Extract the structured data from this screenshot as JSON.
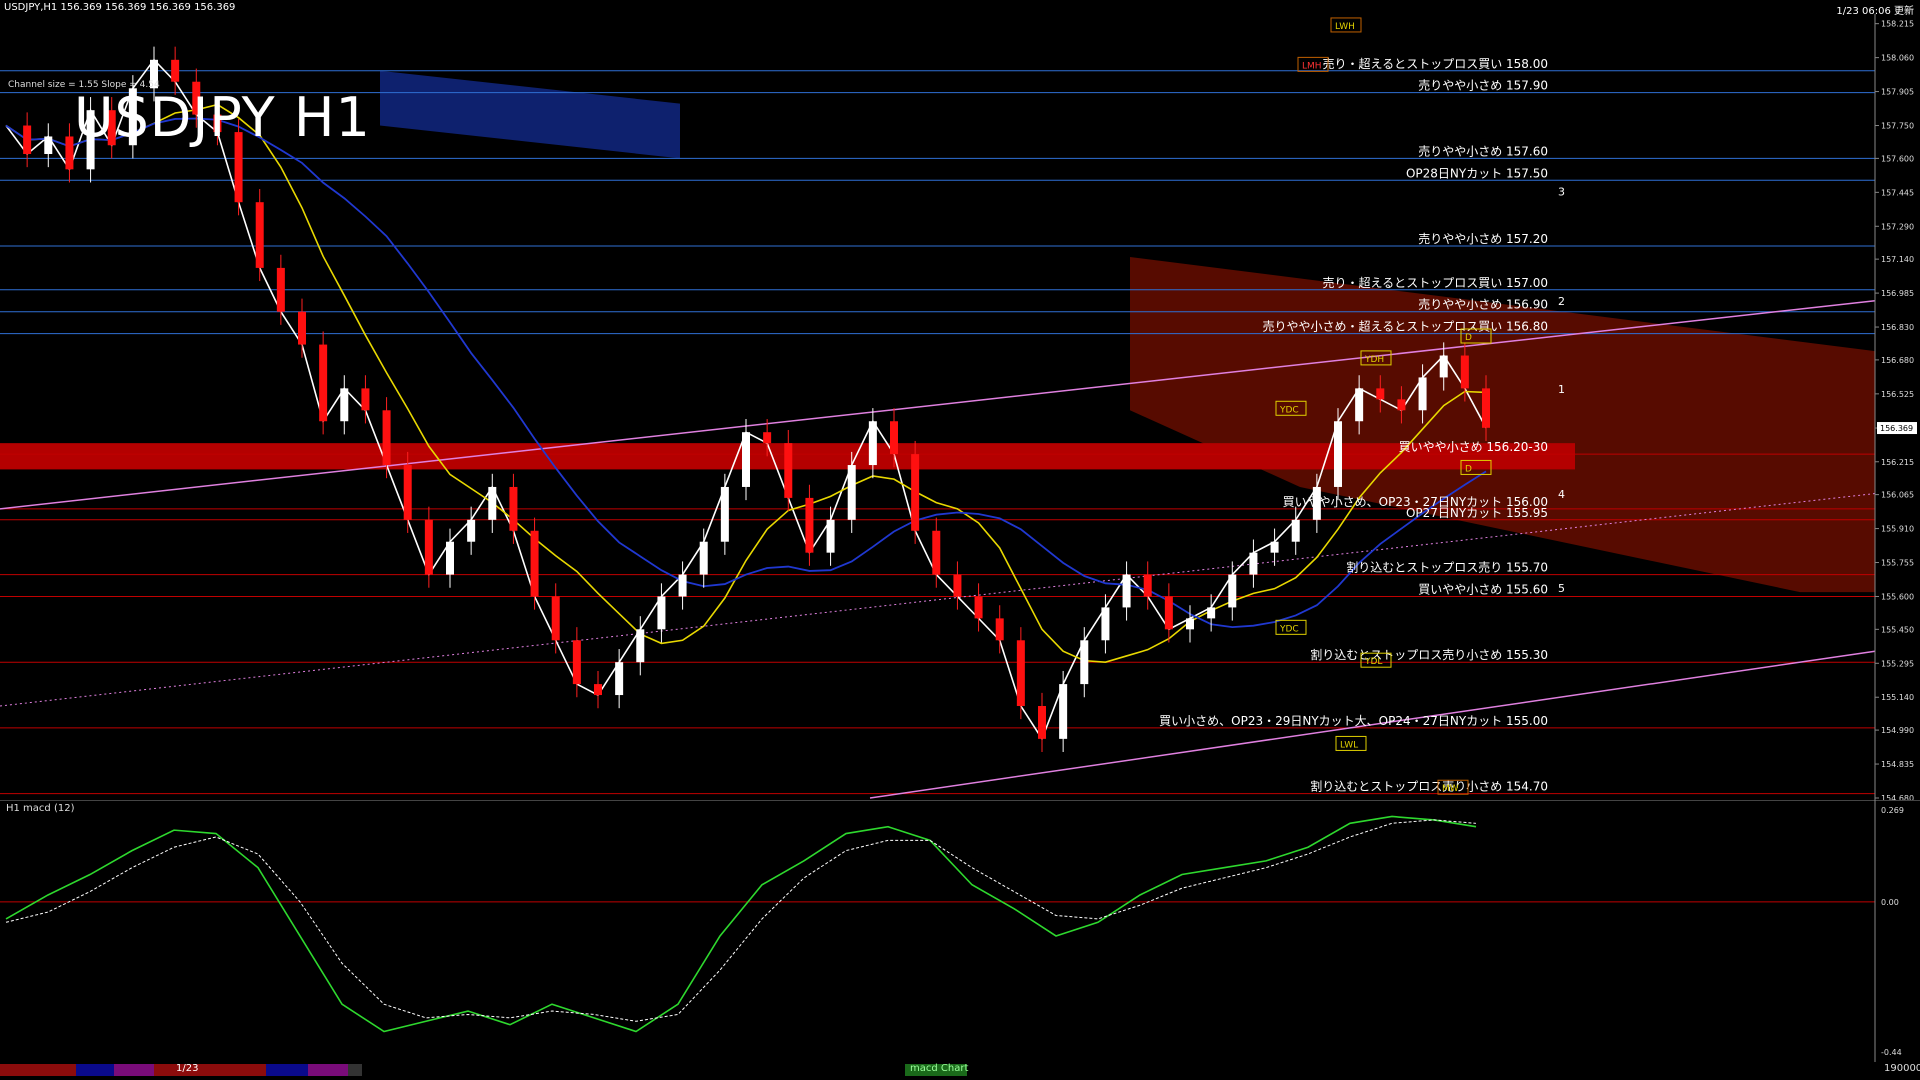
{
  "window": {
    "symbol_info": "USDJPY,H1  156.369 156.369 156.369 156.369",
    "updated": "1/23 06:06 更新",
    "big_title": "USDJPY H1",
    "channel_info": "Channel size = 1.55 Slope = 4.54"
  },
  "chart_data": {
    "type": "line",
    "title": "USDJPY H1",
    "ylim": [
      154.68,
      158.25
    ],
    "yticks": [
      "158.215",
      "158.060",
      "157.905",
      "157.750",
      "157.600",
      "157.445",
      "157.290",
      "157.140",
      "156.985",
      "156.830",
      "156.680",
      "156.525",
      "156.369",
      "156.215",
      "156.065",
      "155.910",
      "155.755",
      "155.600",
      "155.450",
      "155.295",
      "155.140",
      "154.990",
      "154.835",
      "154.680"
    ],
    "current_price": "156.369",
    "close_series": [
      157.75,
      157.62,
      157.7,
      157.55,
      157.82,
      157.66,
      157.92,
      158.05,
      157.95,
      157.8,
      157.72,
      157.4,
      157.1,
      156.9,
      156.75,
      156.4,
      156.55,
      156.45,
      156.2,
      155.95,
      155.7,
      155.85,
      155.95,
      156.1,
      155.9,
      155.6,
      155.4,
      155.2,
      155.15,
      155.3,
      155.45,
      155.6,
      155.7,
      155.85,
      156.1,
      156.35,
      156.3,
      156.05,
      155.8,
      155.95,
      156.2,
      156.4,
      156.25,
      155.9,
      155.7,
      155.6,
      155.5,
      155.4,
      155.1,
      154.95,
      155.2,
      155.4,
      155.55,
      155.7,
      155.6,
      155.45,
      155.5,
      155.55,
      155.7,
      155.8,
      155.85,
      155.95,
      156.1,
      156.4,
      156.55,
      156.5,
      156.45,
      156.6,
      156.7,
      156.55,
      156.37
    ],
    "levels": [
      {
        "label": "売り・超えるとストップロス買い 158.00",
        "value": 158.0,
        "color": "#2f6fd4"
      },
      {
        "label": "売りやや小さめ 157.90",
        "value": 157.9,
        "color": "#2f6fd4"
      },
      {
        "label": "売りやや小さめ 157.60",
        "value": 157.6,
        "color": "#2f6fd4"
      },
      {
        "label": "OP28日NYカット 157.50",
        "value": 157.5,
        "color": "#2f6fd4"
      },
      {
        "label": "売りやや小さめ 157.20",
        "value": 157.2,
        "color": "#2f6fd4"
      },
      {
        "label": "売り・超えるとストップロス買い 157.00",
        "value": 157.0,
        "color": "#2f6fd4"
      },
      {
        "label": "売りやや小さめ 156.90",
        "value": 156.9,
        "color": "#2f6fd4"
      },
      {
        "label": "売りやや小さめ・超えるとストップロス買い 156.80",
        "value": 156.8,
        "color": "#2f6fd4"
      },
      {
        "label": "買いやや小さめ 156.20-30",
        "value": 156.25,
        "color": "#c00000"
      },
      {
        "label": "買いやや小さめ、OP23・27日NYカット 156.00",
        "value": 156.0,
        "color": "#c00000"
      },
      {
        "label": "OP27日NYカット 155.95",
        "value": 155.95,
        "color": "#c00000"
      },
      {
        "label": "割り込むとストップロス売り 155.70",
        "value": 155.7,
        "color": "#c00000"
      },
      {
        "label": "買いやや小さめ 155.60",
        "value": 155.6,
        "color": "#c00000"
      },
      {
        "label": "割り込むとストップロス売り小さめ 155.30",
        "value": 155.3,
        "color": "#c00000"
      },
      {
        "label": "買い小さめ、OP23・29日NYカット大、OP24・27日NYカット 155.00",
        "value": 155.0,
        "color": "#c00000"
      },
      {
        "label": "割り込むとストップロス売り小さめ 154.70",
        "value": 154.7,
        "color": "#c00000"
      }
    ],
    "markers": [
      "LWH",
      "LMH",
      "YDH",
      "YDC",
      "YDC",
      "YDL",
      "LWL",
      "MW",
      "D",
      "D"
    ],
    "projection_labels": [
      "1",
      "2",
      "3",
      "4",
      "5"
    ]
  },
  "macd": {
    "label": "H1  macd (12)",
    "ylim": [
      -0.44,
      0.269
    ],
    "yticks": [
      "0.269",
      "0.00",
      "-0.44"
    ],
    "main": [
      -0.05,
      0.02,
      0.08,
      0.15,
      0.21,
      0.2,
      0.1,
      -0.1,
      -0.3,
      -0.38,
      -0.35,
      -0.32,
      -0.36,
      -0.3,
      -0.34,
      -0.38,
      -0.3,
      -0.1,
      0.05,
      0.12,
      0.2,
      0.22,
      0.18,
      0.05,
      -0.02,
      -0.1,
      -0.06,
      0.02,
      0.08,
      0.1,
      0.12,
      0.16,
      0.23,
      0.25,
      0.24,
      0.22
    ],
    "signal": [
      -0.06,
      -0.03,
      0.03,
      0.1,
      0.16,
      0.19,
      0.14,
      0.0,
      -0.18,
      -0.3,
      -0.34,
      -0.33,
      -0.34,
      -0.32,
      -0.33,
      -0.35,
      -0.33,
      -0.2,
      -0.05,
      0.07,
      0.15,
      0.18,
      0.18,
      0.1,
      0.03,
      -0.04,
      -0.05,
      -0.01,
      0.04,
      0.07,
      0.1,
      0.14,
      0.19,
      0.23,
      0.24,
      0.23
    ]
  },
  "footer": {
    "date_label": "1/23",
    "macd_tab": "macd Chart",
    "bottom_right": "190000"
  },
  "colors": {
    "ichimoku_cloud": "#c01800",
    "blue_cloud": "#1a3cc8",
    "sma_yellow": "#e8d800",
    "sma_blue": "#2038d0",
    "sma_white": "#ffffff",
    "rsi_green": "#1ec81e",
    "channel": "#e080e0"
  }
}
